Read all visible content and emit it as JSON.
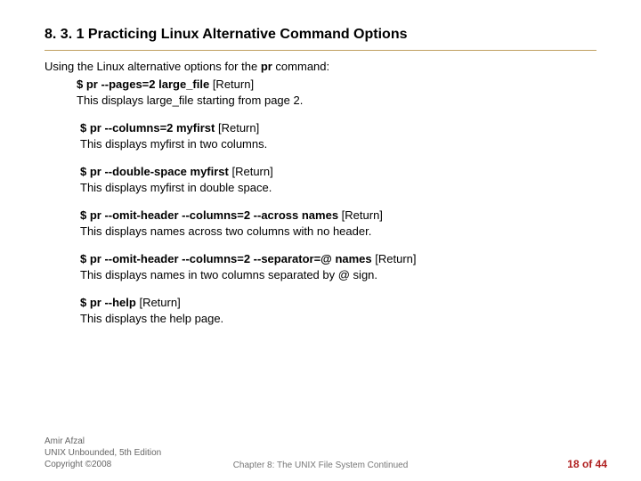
{
  "title": "8. 3. 1 Practicing Linux Alternative Command Options",
  "intro_prefix": "Using the Linux alternative options for the ",
  "intro_cmd": "pr",
  "intro_suffix": " command:",
  "examples": [
    {
      "cmd": "$ pr --pages=2 large_file",
      "ret": " [Return]",
      "desc": "This displays large_file starting from page 2."
    },
    {
      "cmd": "$ pr --columns=2 myfirst",
      "ret": " [Return]",
      "desc": "This displays myfirst in two columns."
    },
    {
      "cmd": "$ pr --double-space myfirst",
      "ret": " [Return]",
      "desc": "This displays myfirst in double space."
    },
    {
      "cmd": "$ pr --omit-header --columns=2 --across names",
      "ret": " [Return]",
      "desc": "This displays names across two columns with no header."
    },
    {
      "cmd": "$ pr --omit-header --columns=2 --separator=@ names",
      "ret": " [Return]",
      "desc": "This displays names in two columns separated by @ sign."
    },
    {
      "cmd": "$ pr --help",
      "ret": " [Return]",
      "desc": "This displays the help page."
    }
  ],
  "footer": {
    "author": "Amir Afzal",
    "book": "UNIX Unbounded, 5th Edition",
    "copyright": "Copyright ©2008",
    "chapter": "Chapter 8: The UNIX File System Continued",
    "page": "18 of 44"
  }
}
